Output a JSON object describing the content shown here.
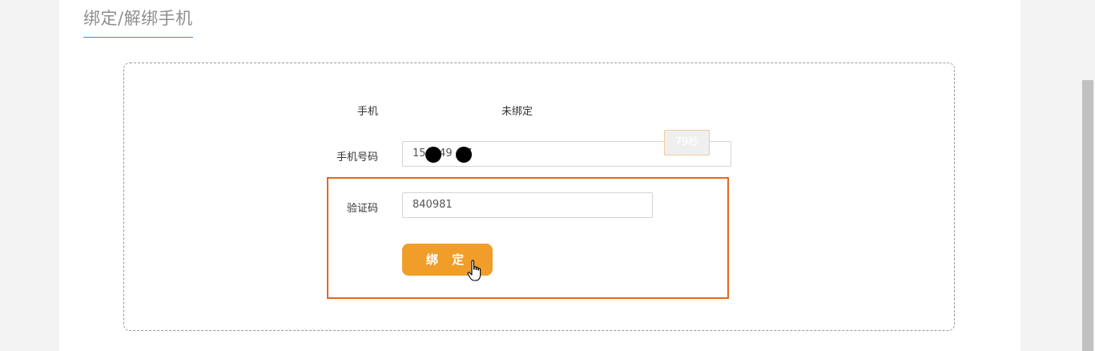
{
  "section": {
    "title": "绑定/解绑手机"
  },
  "form": {
    "phone_label": "手机",
    "phone_status": "未绑定",
    "phone_number_label": "手机号码",
    "phone_number_value": "15  249  07",
    "code_label": "验证码",
    "code_value": "840981",
    "countdown_label": "79秒",
    "bind_button_label": "绑 定"
  },
  "colors": {
    "accent": "#f09d2a",
    "highlight": "#e8651f",
    "title_underline": "#3a8fd6"
  }
}
